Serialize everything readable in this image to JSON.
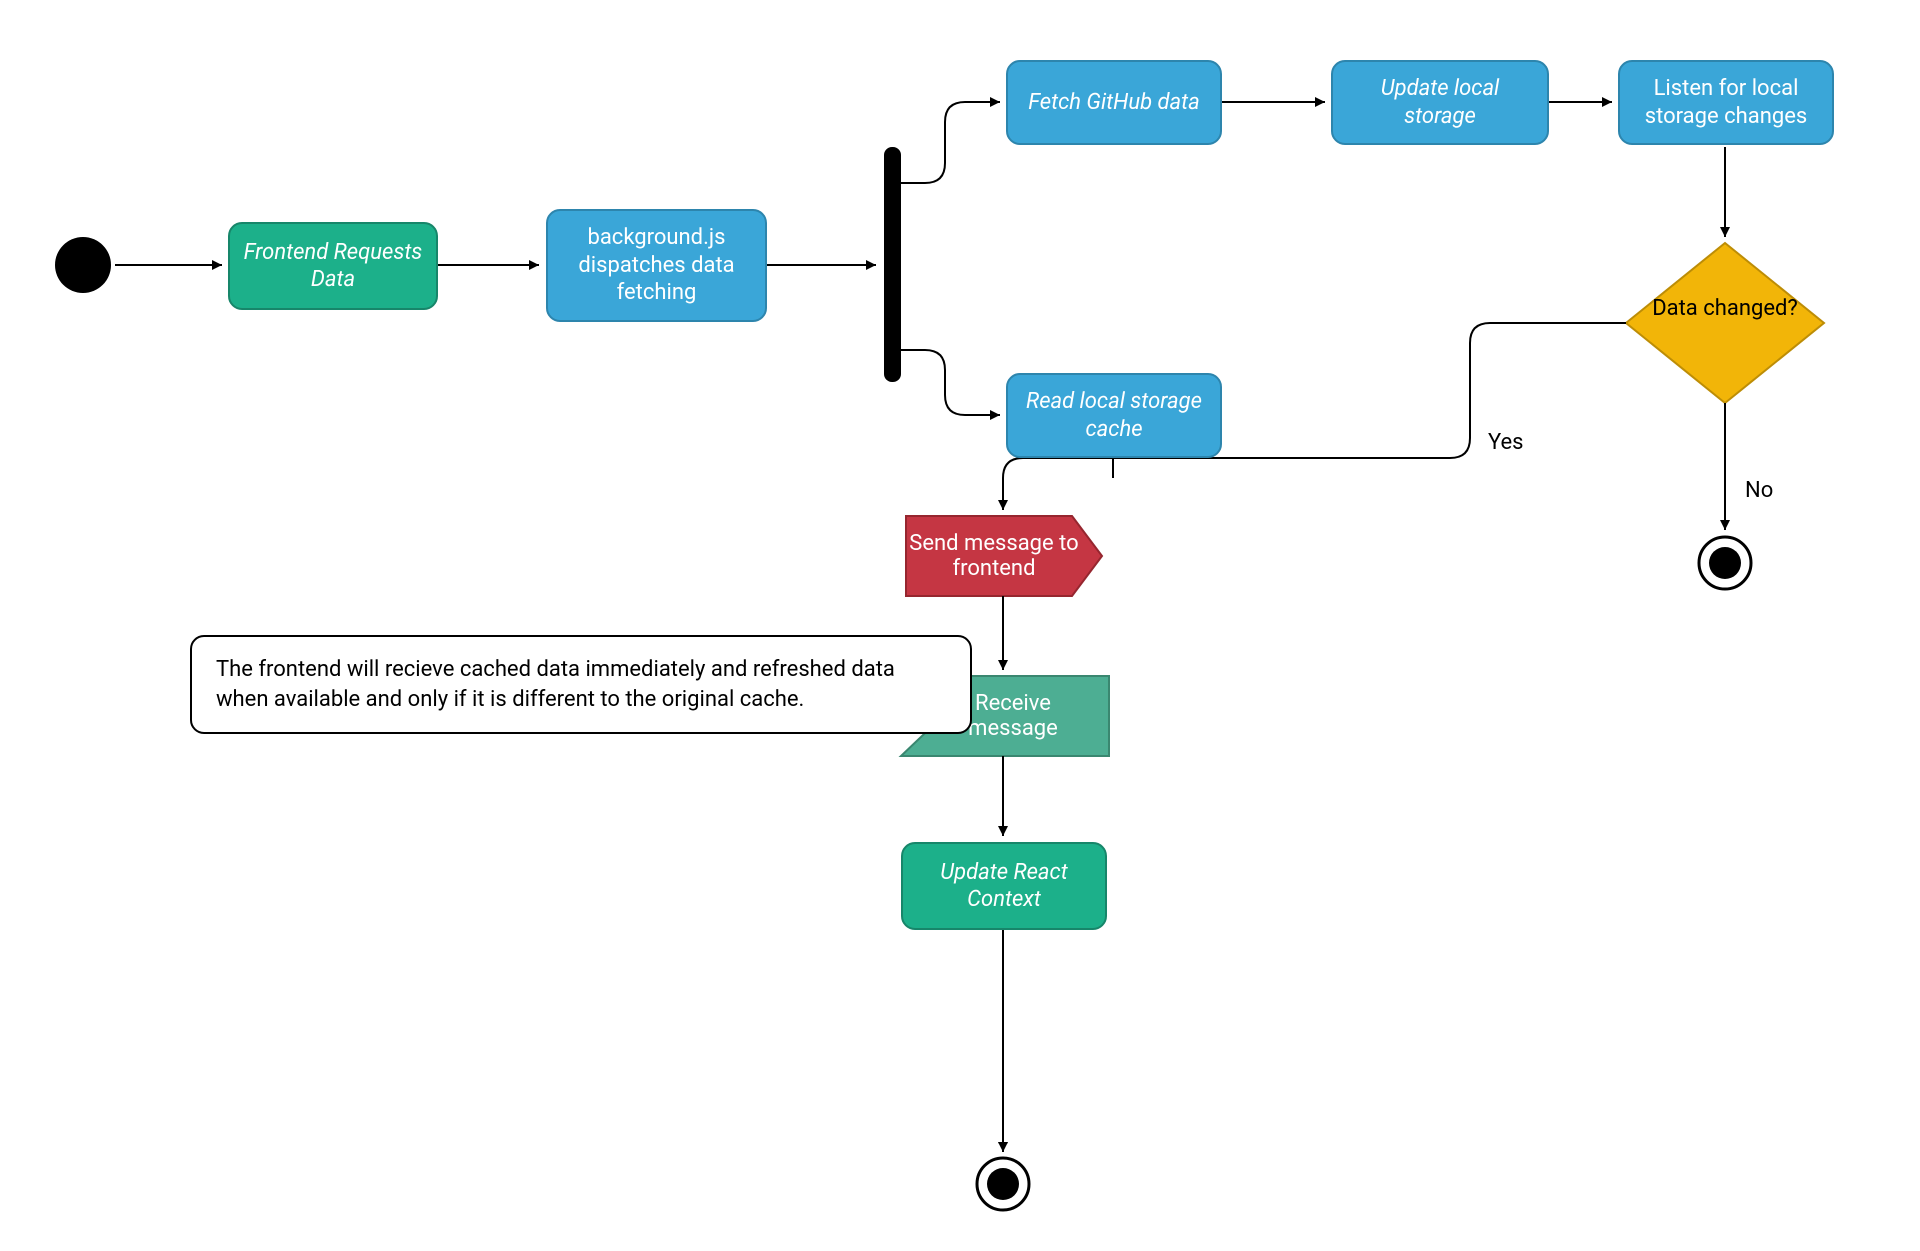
{
  "chart_data": {
    "type": "table",
    "diagram_type": "activity-flowchart",
    "nodes": [
      {
        "id": "start",
        "type": "initial",
        "label": ""
      },
      {
        "id": "frontend-req",
        "type": "action",
        "label": "Frontend Requests Data",
        "style": "teal",
        "italic": true
      },
      {
        "id": "dispatch",
        "type": "action",
        "label": "background.js dispatches data fetching",
        "style": "blue"
      },
      {
        "id": "fork",
        "type": "fork",
        "label": ""
      },
      {
        "id": "fetch",
        "type": "action",
        "label": "Fetch GitHub data",
        "style": "blue",
        "italic": true
      },
      {
        "id": "update-storage",
        "type": "action",
        "label": "Update local storage",
        "style": "blue",
        "italic": true
      },
      {
        "id": "listen",
        "type": "action",
        "label": "Listen for local storage changes",
        "style": "blue"
      },
      {
        "id": "read-cache",
        "type": "action",
        "label": "Read local storage cache",
        "style": "blue",
        "italic": true
      },
      {
        "id": "decision",
        "type": "decision",
        "label": "Data changed?",
        "style": "yellow"
      },
      {
        "id": "send-msg",
        "type": "signal-send",
        "label": "Send message to frontend",
        "style": "red"
      },
      {
        "id": "recv-msg",
        "type": "signal-receive",
        "label": "Receive message",
        "style": "green"
      },
      {
        "id": "update-react",
        "type": "action",
        "label": "Update React Context",
        "style": "teal",
        "italic": true
      },
      {
        "id": "end1",
        "type": "final",
        "label": ""
      },
      {
        "id": "end2",
        "type": "final",
        "label": ""
      }
    ],
    "edges": [
      {
        "from": "start",
        "to": "frontend-req"
      },
      {
        "from": "frontend-req",
        "to": "dispatch"
      },
      {
        "from": "dispatch",
        "to": "fork"
      },
      {
        "from": "fork",
        "to": "fetch"
      },
      {
        "from": "fork",
        "to": "read-cache"
      },
      {
        "from": "fetch",
        "to": "update-storage"
      },
      {
        "from": "update-storage",
        "to": "listen"
      },
      {
        "from": "listen",
        "to": "decision"
      },
      {
        "from": "decision",
        "to": "send-msg",
        "label": "Yes"
      },
      {
        "from": "decision",
        "to": "end2",
        "label": "No"
      },
      {
        "from": "read-cache",
        "to": "send-msg"
      },
      {
        "from": "send-msg",
        "to": "recv-msg"
      },
      {
        "from": "recv-msg",
        "to": "update-react"
      },
      {
        "from": "update-react",
        "to": "end1"
      }
    ],
    "note": "The frontend will recieve cached data immediately and refreshed data when available and only if it is different to the original cache."
  },
  "colors": {
    "teal": "#1cb08a",
    "blue": "#3aa6d8",
    "yellow": "#f2b508",
    "red": "#c53643",
    "green": "#4dae93"
  },
  "labels": {
    "frontend_req": "Frontend Requests Data",
    "dispatch": "background.js dispatches data fetching",
    "fetch": "Fetch GitHub data",
    "update_storage": "Update local storage",
    "listen": "Listen for local storage changes",
    "read_cache": "Read local storage cache",
    "decision": "Data changed?",
    "send_msg": "Send message to frontend",
    "recv_msg": "Receive message",
    "update_react": "Update React Context",
    "yes": "Yes",
    "no": "No",
    "note": "The frontend will recieve cached data immediately and refreshed data when available and only if it is different to the original cache."
  }
}
